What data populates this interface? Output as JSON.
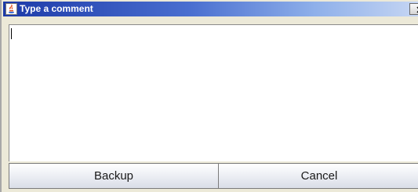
{
  "window": {
    "title": "Type a comment",
    "close_glyph": "X",
    "title_icon": "java-coffee-icon"
  },
  "comment": {
    "value": ""
  },
  "buttons": {
    "backup_label": "Backup",
    "cancel_label": "Cancel"
  },
  "colors": {
    "titlebar_start": "#1c3aa8",
    "titlebar_end": "#c6d6f3",
    "button_face": "#eef0f5"
  }
}
